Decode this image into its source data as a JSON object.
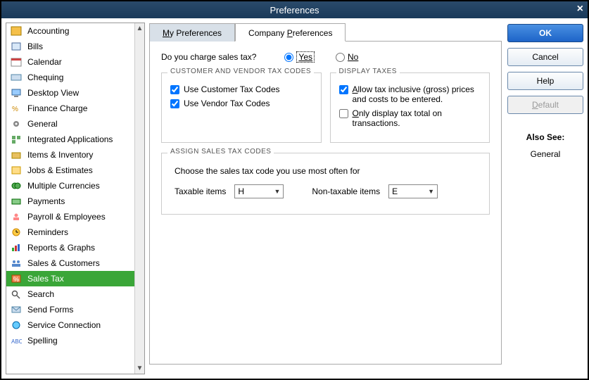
{
  "title": "Preferences",
  "sidebar": {
    "items": [
      {
        "label": "Accounting",
        "icon": "ledger"
      },
      {
        "label": "Bills",
        "icon": "bills"
      },
      {
        "label": "Calendar",
        "icon": "calendar"
      },
      {
        "label": "Chequing",
        "icon": "cheque"
      },
      {
        "label": "Desktop View",
        "icon": "desktop"
      },
      {
        "label": "Finance Charge",
        "icon": "finance"
      },
      {
        "label": "General",
        "icon": "gear"
      },
      {
        "label": "Integrated Applications",
        "icon": "apps"
      },
      {
        "label": "Items & Inventory",
        "icon": "inventory"
      },
      {
        "label": "Jobs & Estimates",
        "icon": "jobs"
      },
      {
        "label": "Multiple Currencies",
        "icon": "currency"
      },
      {
        "label": "Payments",
        "icon": "payments"
      },
      {
        "label": "Payroll & Employees",
        "icon": "payroll"
      },
      {
        "label": "Reminders",
        "icon": "clock"
      },
      {
        "label": "Reports & Graphs",
        "icon": "graph"
      },
      {
        "label": "Sales & Customers",
        "icon": "customers"
      },
      {
        "label": "Sales Tax",
        "icon": "percent",
        "active": true
      },
      {
        "label": "Search",
        "icon": "search"
      },
      {
        "label": "Send Forms",
        "icon": "send"
      },
      {
        "label": "Service Connection",
        "icon": "globe"
      },
      {
        "label": "Spelling",
        "icon": "abc"
      }
    ]
  },
  "tabs": {
    "my": "My Preferences",
    "company": "Company Preferences",
    "active": "company"
  },
  "question": "Do you charge sales tax?",
  "radios": {
    "yes": "Yes",
    "no": "No",
    "selected": "yes"
  },
  "group_customer": {
    "title": "CUSTOMER AND VENDOR TAX CODES",
    "use_customer": "Use Customer Tax Codes",
    "use_vendor": "Use Vendor Tax Codes",
    "use_customer_checked": true,
    "use_vendor_checked": true
  },
  "group_display": {
    "title": "DISPLAY TAXES",
    "allow_gross": "Allow tax inclusive (gross) prices and costs to be entered.",
    "only_total": "Only display tax total on transactions.",
    "allow_gross_checked": true,
    "only_total_checked": false
  },
  "assign": {
    "title": "ASSIGN SALES TAX CODES",
    "instruction": "Choose the sales tax code you use most often for",
    "taxable_label": "Taxable items",
    "taxable_value": "H",
    "nontax_label": "Non-taxable items",
    "nontax_value": "E"
  },
  "buttons": {
    "ok": "OK",
    "cancel": "Cancel",
    "help": "Help",
    "default": "Default"
  },
  "also_see": {
    "title": "Also See:",
    "link": "General"
  }
}
